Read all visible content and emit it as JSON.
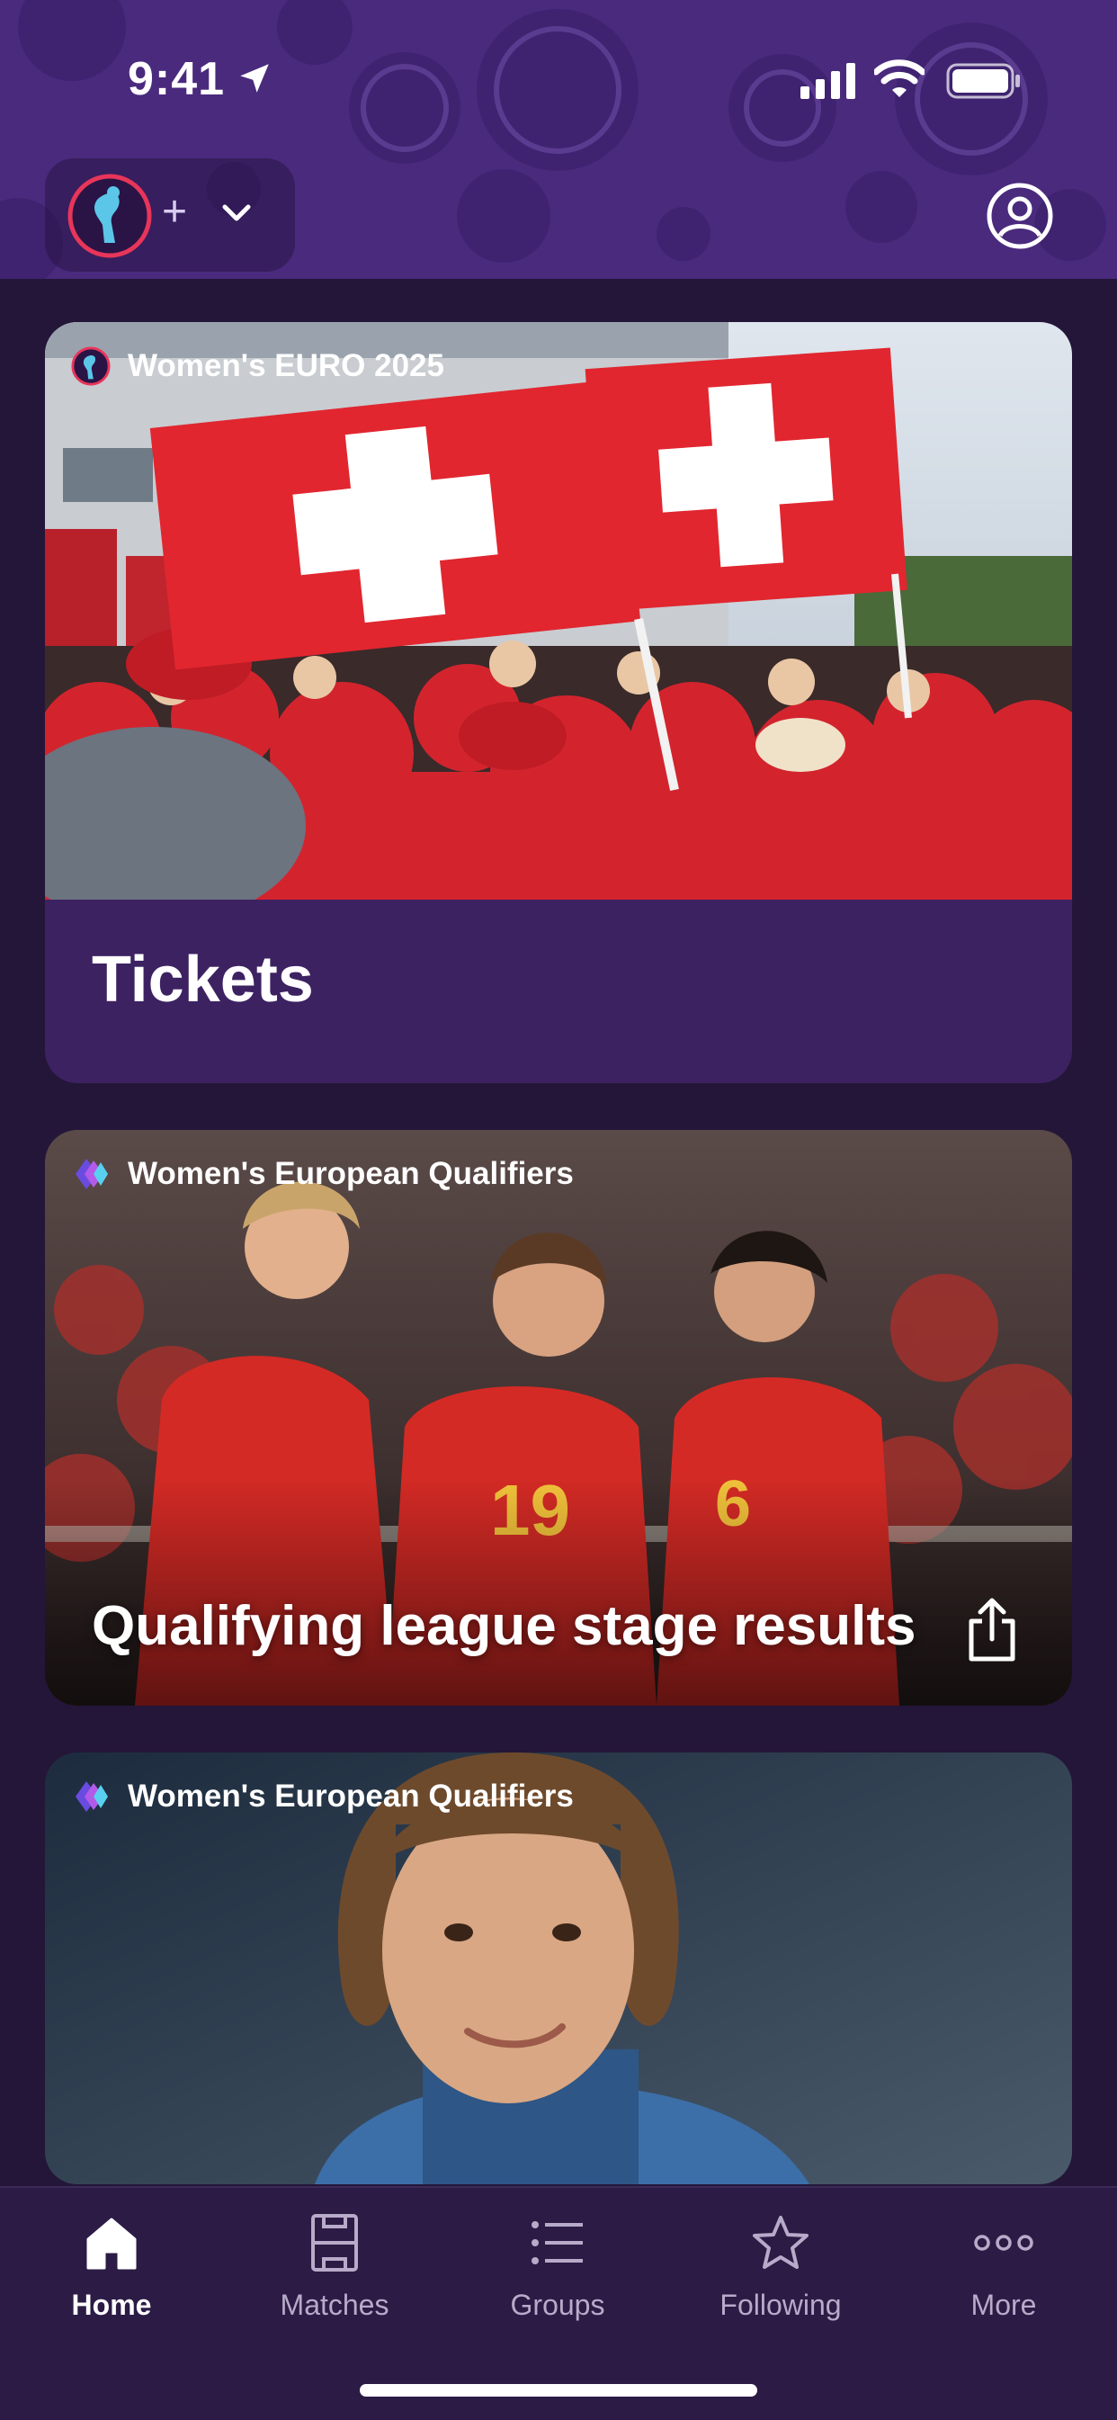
{
  "status_bar": {
    "time": "9:41"
  },
  "header": {
    "switcher_plus": "+"
  },
  "feed": [
    {
      "tag": "Women's EURO 2025",
      "title": "Tickets"
    },
    {
      "tag": "Women's European Qualifiers",
      "title": "Qualifying league stage results"
    },
    {
      "tag": "Women's European Qualifiers",
      "title": ""
    }
  ],
  "tabs": [
    {
      "label": "Home",
      "icon": "home-icon",
      "active": true
    },
    {
      "label": "Matches",
      "icon": "pitch-icon",
      "active": false
    },
    {
      "label": "Groups",
      "icon": "list-icon",
      "active": false
    },
    {
      "label": "Following",
      "icon": "star-icon",
      "active": false
    },
    {
      "label": "More",
      "icon": "ellipsis-icon",
      "active": false
    }
  ],
  "colors": {
    "header": "#4a2a7d",
    "background": "#241639",
    "card": "#3d2262",
    "tab_bar": "#2b1b45",
    "inactive_tab": "#b7abc9"
  }
}
